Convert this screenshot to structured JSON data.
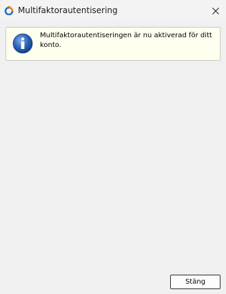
{
  "window": {
    "title": "Multifaktorautentisering"
  },
  "message": {
    "text": "Multifaktorautentiseringen är nu aktiverad för ditt konto."
  },
  "footer": {
    "close_label": "Stäng"
  },
  "icons": {
    "app": "app-logo-icon",
    "info": "info-icon",
    "close": "close-icon"
  },
  "colors": {
    "info_box_background": "#fffff0",
    "info_icon": "#1f5fb4"
  }
}
